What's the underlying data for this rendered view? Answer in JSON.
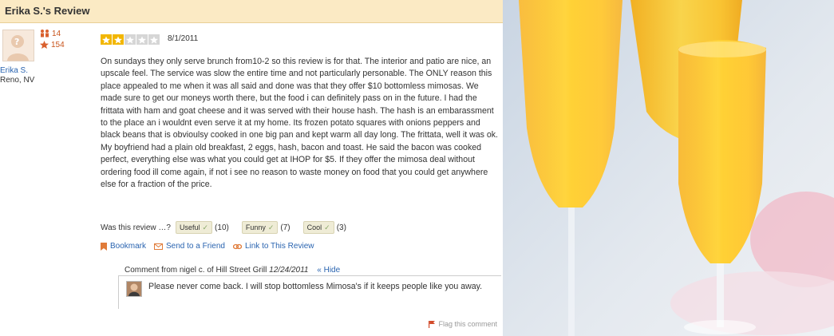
{
  "header": {
    "title": "Erika S.'s Review"
  },
  "user": {
    "name": "Erika S.",
    "location": "Reno, NV",
    "friends_count": "14",
    "reviews_count": "154",
    "avatar_icon": "default-avatar-icon"
  },
  "review": {
    "rating": 2,
    "rating_max": 5,
    "date": "8/1/2011",
    "text": "On sundays they only serve brunch from10-2 so this review is for that. The interior and patio are nice, an upscale feel. The service was slow the entire time and not particularly personable. The ONLY reason this place appealed to me when it was all said and done was that they offer $10 bottomless mimosas. We made sure to get our moneys worth there, but the food i can definitely pass on in the future. I had the frittata with ham and goat cheese and it was served with their house hash. The hash is an embarassment to the place an i wouldnt even serve it at my home. Its frozen potato squares with onions peppers and black beans that is obvioulsy cooked in one big pan and kept warm all day long. The frittata, well it was ok. My boyfriend had a plain old breakfast, 2 eggs, hash, bacon and toast. He said the bacon was cooked perfect, everything else was what you could get at IHOP for $5. If they offer the mimosa deal without ordering food ill come again, if not i see no reason to waste money on food that you could get anywhere else for a fraction of the price."
  },
  "votes": {
    "prompt": "Was this review …?",
    "useful_label": "Useful",
    "useful_count": "(10)",
    "funny_label": "Funny",
    "funny_count": "(7)",
    "cool_label": "Cool",
    "cool_count": "(3)"
  },
  "actions": {
    "bookmark": "Bookmark",
    "send": "Send to a Friend",
    "link": "Link to This Review"
  },
  "comment": {
    "prefix": "Comment from nigel c. of Hill Street Grill",
    "date": "12/24/2011",
    "hide": "« Hide",
    "text": "Please never come back. I will stop bottomless Mimosa's if it keeps people like you away."
  },
  "flag": {
    "label": "Flag this comment"
  },
  "colors": {
    "header_bg": "#fbeac4",
    "link": "#2a64b0",
    "star_on": "#f2b600",
    "accent": "#c8531b"
  }
}
